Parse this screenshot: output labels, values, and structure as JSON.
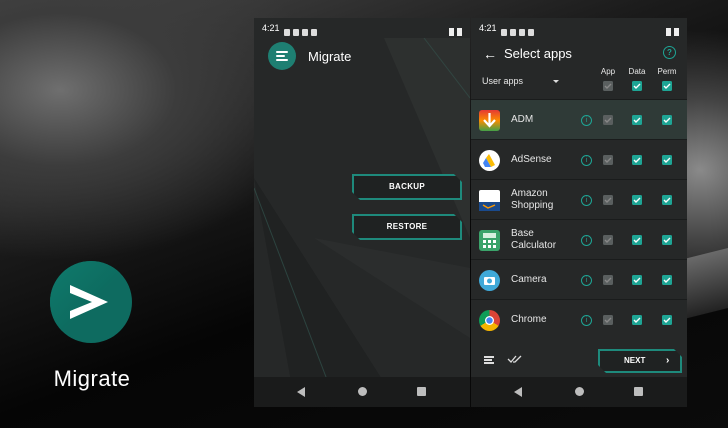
{
  "hero": {
    "app_name": "Migrate"
  },
  "status": {
    "time_left": "4:21",
    "time_right": "4:21"
  },
  "main_screen": {
    "title": "Migrate",
    "backup_label": "BACKUP",
    "restore_label": "RESTORE"
  },
  "select_screen": {
    "title": "Select apps",
    "filter_label": "User apps",
    "columns": {
      "app": "App",
      "data": "Data",
      "perm": "Perm"
    },
    "rows": [
      {
        "name": "ADM",
        "selected": true,
        "icon": "adm-icon"
      },
      {
        "name": "AdSense",
        "icon": "adsense-icon"
      },
      {
        "name": "Amazon\nShopping",
        "icon": "amazon-icon"
      },
      {
        "name": "Base\nCalculator",
        "icon": "calculator-icon"
      },
      {
        "name": "Camera",
        "icon": "camera-icon"
      },
      {
        "name": "Chrome",
        "icon": "chrome-icon"
      }
    ],
    "next_label": "NEXT"
  },
  "colors": {
    "accent": "#1ea595",
    "accent_dark": "#0e6b60",
    "background": "#262828"
  }
}
